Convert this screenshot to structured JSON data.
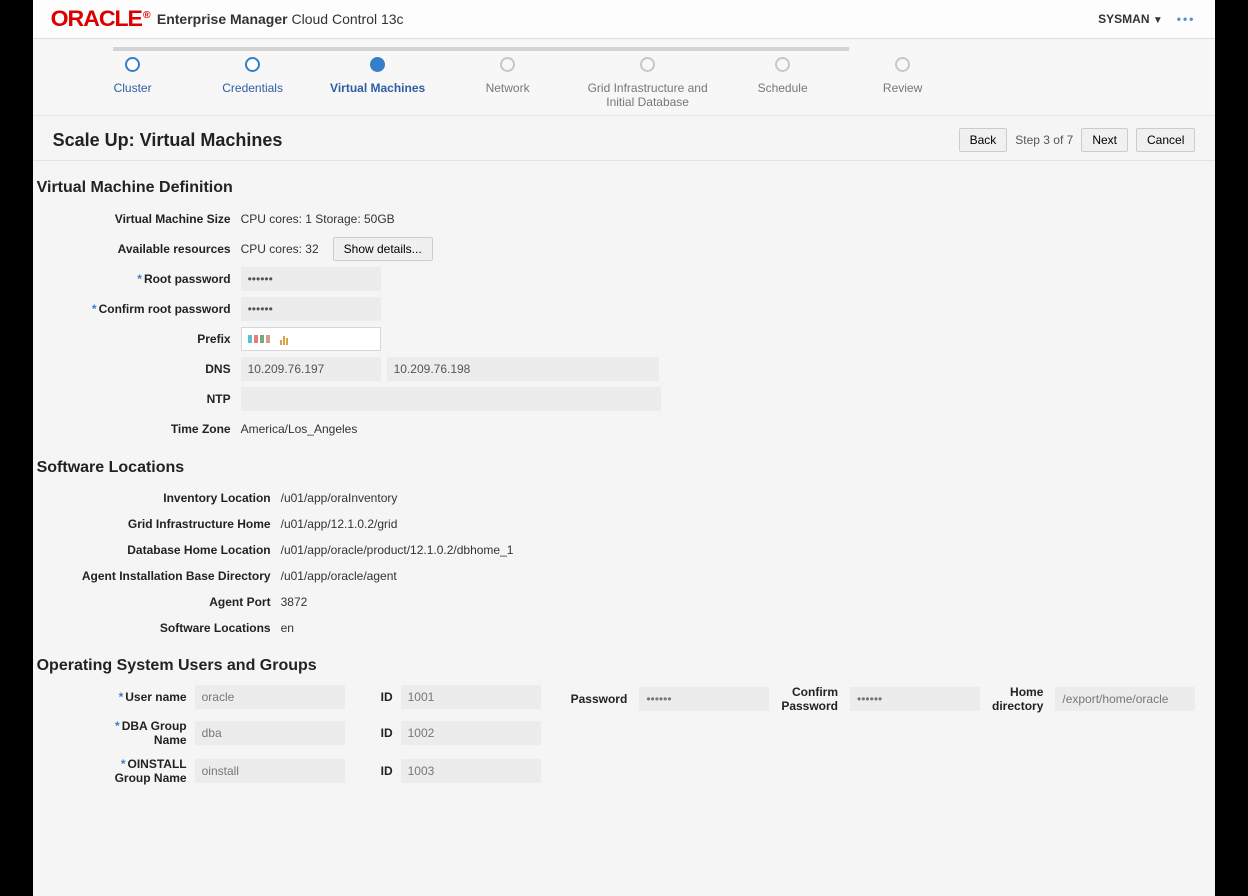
{
  "header": {
    "brand": "ORACLE",
    "product_bold": "Enterprise Manager",
    "product_rest": "Cloud Control 13c",
    "user": "SYSMAN"
  },
  "train": {
    "steps": [
      {
        "label": "Cluster",
        "state": "past"
      },
      {
        "label": "Credentials",
        "state": "past"
      },
      {
        "label": "Virtual Machines",
        "state": "current"
      },
      {
        "label": "Network",
        "state": "future"
      },
      {
        "label": "Grid Infrastructure and Initial Database",
        "state": "future"
      },
      {
        "label": "Schedule",
        "state": "future"
      },
      {
        "label": "Review",
        "state": "future"
      }
    ]
  },
  "titlebar": {
    "title": "Scale Up: Virtual Machines",
    "back": "Back",
    "indicator": "Step 3 of 7",
    "next": "Next",
    "cancel": "Cancel"
  },
  "sections": {
    "vmdef_title": "Virtual Machine Definition",
    "sw_title": "Software Locations",
    "os_title": "Operating System Users and Groups"
  },
  "vmdef": {
    "size_label": "Virtual Machine Size",
    "size_value": "CPU cores: 1 Storage: 50GB",
    "avail_label": "Available resources",
    "avail_value": "CPU cores: 32",
    "show_details": "Show details...",
    "root_pw_label": "Root password",
    "root_pw_value": "••••••",
    "root_pw2_label": "Confirm root password",
    "root_pw2_value": "••••••",
    "prefix_label": "Prefix",
    "dns_label": "DNS",
    "dns1": "10.209.76.197",
    "dns2": "10.209.76.198",
    "ntp_label": "NTP",
    "ntp_value": "",
    "tz_label": "Time Zone",
    "tz_value": "America/Los_Angeles"
  },
  "sw": {
    "inv_label": "Inventory Location",
    "inv_value": "/u01/app/oraInventory",
    "gi_label": "Grid Infrastructure Home",
    "gi_value": "/u01/app/12.1.0.2/grid",
    "db_label": "Database Home Location",
    "db_value": "/u01/app/oracle/product/12.1.0.2/dbhome_1",
    "agent_label": "Agent Installation Base Directory",
    "agent_value": "/u01/app/oracle/agent",
    "port_label": "Agent Port",
    "port_value": "3872",
    "loc_label": "Software Locations",
    "loc_value": "en"
  },
  "os": {
    "user_label": "User name",
    "user_value": "oracle",
    "id_label": "ID",
    "user_id": "1001",
    "pw_label": "Password",
    "pw_value": "••••••",
    "cpw_label_l1": "Confirm",
    "cpw_label_l2": "Password",
    "cpw_value": "••••••",
    "home_l1": "Home",
    "home_l2": "directory",
    "home_value": "/export/home/oracle",
    "dba_label_l1": "DBA Group",
    "dba_label_l2": "Name",
    "dba_value": "dba",
    "dba_id": "1002",
    "oin_label_l1": "OINSTALL",
    "oin_label_l2": "Group Name",
    "oin_value": "oinstall",
    "oin_id": "1003"
  }
}
